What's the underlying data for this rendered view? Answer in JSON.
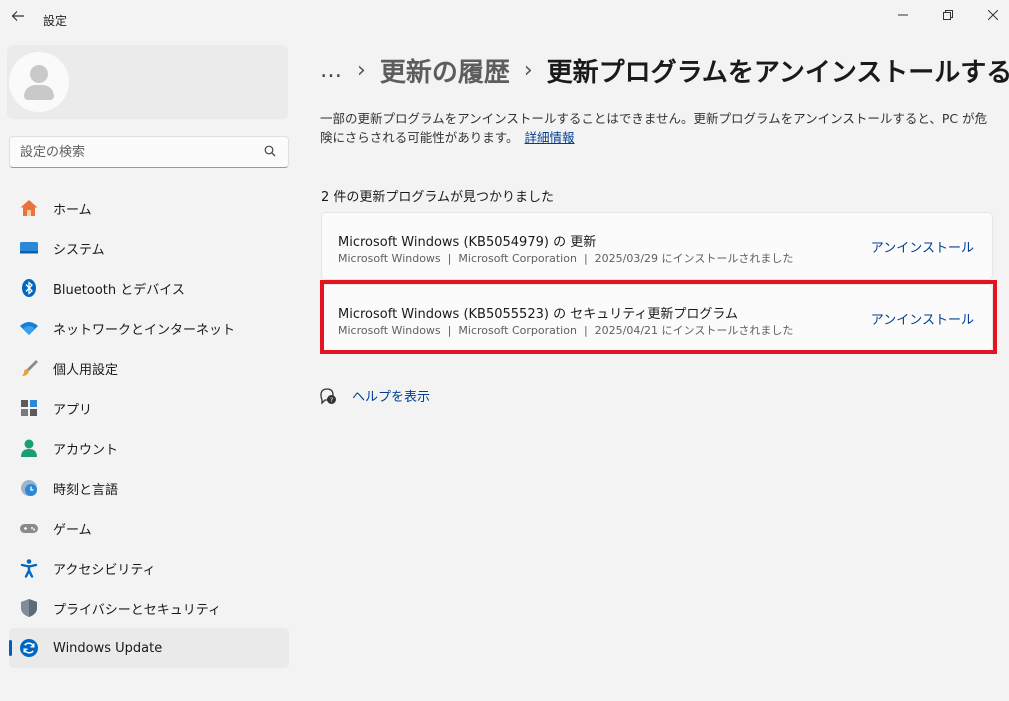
{
  "window": {
    "title": "設定",
    "controls": {
      "minimize": "—",
      "maximize": "❐",
      "close": "✕"
    }
  },
  "sidebar": {
    "search_placeholder": "設定の検索",
    "items": [
      {
        "label": "ホーム",
        "icon": "home-icon"
      },
      {
        "label": "システム",
        "icon": "system-icon"
      },
      {
        "label": "Bluetooth とデバイス",
        "icon": "bluetooth-icon"
      },
      {
        "label": "ネットワークとインターネット",
        "icon": "wifi-icon"
      },
      {
        "label": "個人用設定",
        "icon": "brush-icon"
      },
      {
        "label": "アプリ",
        "icon": "apps-icon"
      },
      {
        "label": "アカウント",
        "icon": "account-icon"
      },
      {
        "label": "時刻と言語",
        "icon": "time-language-icon"
      },
      {
        "label": "ゲーム",
        "icon": "gamepad-icon"
      },
      {
        "label": "アクセシビリティ",
        "icon": "accessibility-icon"
      },
      {
        "label": "プライバシーとセキュリティ",
        "icon": "shield-icon"
      },
      {
        "label": "Windows Update",
        "icon": "windows-update-icon",
        "active": true
      }
    ]
  },
  "breadcrumb": {
    "more": "…",
    "separator": "›",
    "parent": "更新の履歴",
    "current": "更新プログラムをアンインストールする"
  },
  "description": {
    "text": "一部の更新プログラムをアンインストールすることはできません。更新プログラムをアンインストールすると、PC が危険にさらされる可能性があります。",
    "link": "詳細情報"
  },
  "updates": {
    "count_text": "2 件の更新プログラムが見つかりました",
    "items": [
      {
        "name": "Microsoft Windows (KB5054979) の 更新",
        "product": "Microsoft Windows",
        "publisher": "Microsoft Corporation",
        "installed": "2025/03/29 にインストールされました",
        "action": "アンインストール"
      },
      {
        "name": "Microsoft Windows (KB5055523) の セキュリティ更新プログラム",
        "product": "Microsoft Windows",
        "publisher": "Microsoft Corporation",
        "installed": "2025/04/21 にインストールされました",
        "action": "アンインストール"
      }
    ],
    "meta_separator": "|"
  },
  "help": {
    "label": "ヘルプを表示"
  },
  "colors": {
    "accent": "#005fb8",
    "link": "#003e92",
    "highlight": "#e3141f"
  }
}
